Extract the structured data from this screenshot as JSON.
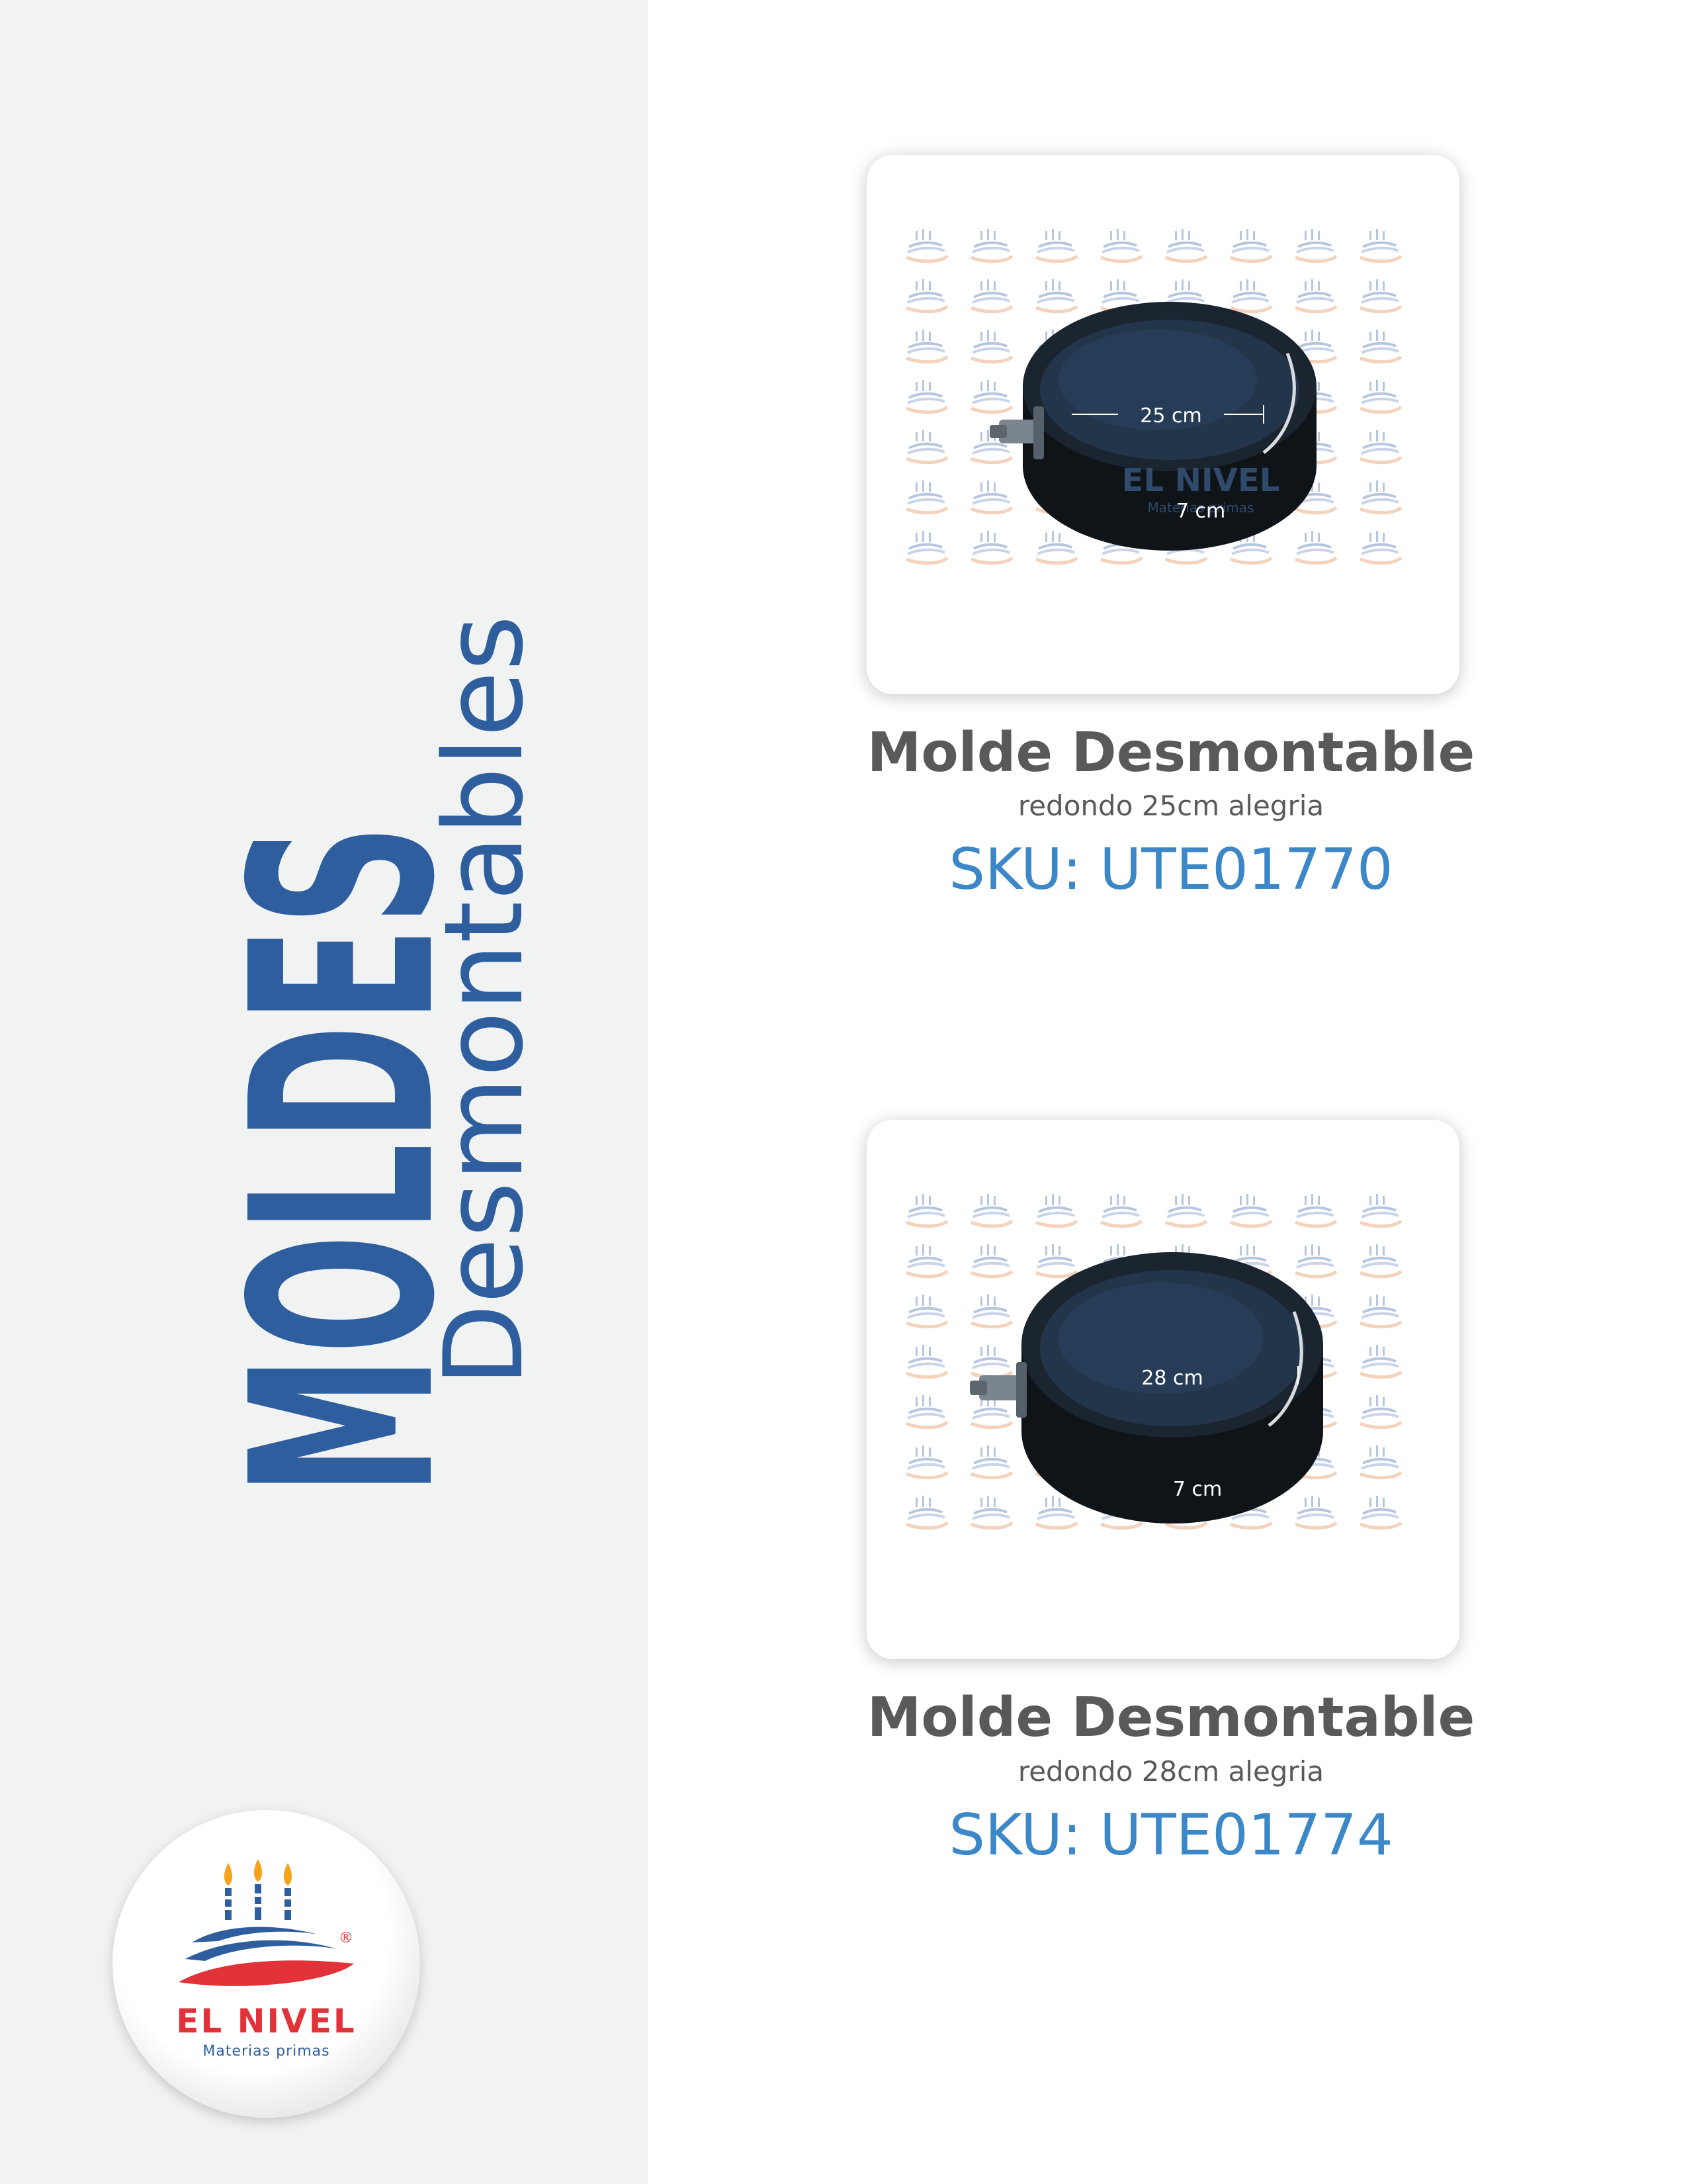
{
  "sidebar": {
    "title": "MOLDES",
    "subtitle": "Desmontables"
  },
  "logo": {
    "name": "EL NIVEL",
    "tagline": "Materias primas",
    "registered": "®"
  },
  "watermark_text": "EL NIVEL",
  "watermark_tagline": "Materias primas",
  "products": [
    {
      "name": "Molde Desmontable",
      "description": "redondo 25cm alegria",
      "sku": "SKU: UTE01770",
      "diameter_label": "25 cm",
      "height_label": "7 cm"
    },
    {
      "name": "Molde Desmontable",
      "description": "redondo 28cm alegria",
      "sku": "SKU: UTE01774",
      "diameter_label": "28 cm",
      "height_label": "7 cm"
    }
  ],
  "colors": {
    "brand_blue": "#2e5e9e",
    "sku_blue": "#3b87c7",
    "text_gray": "#58595b",
    "logo_red": "#e03238",
    "sidebar_bg": "#f1f3f3"
  }
}
